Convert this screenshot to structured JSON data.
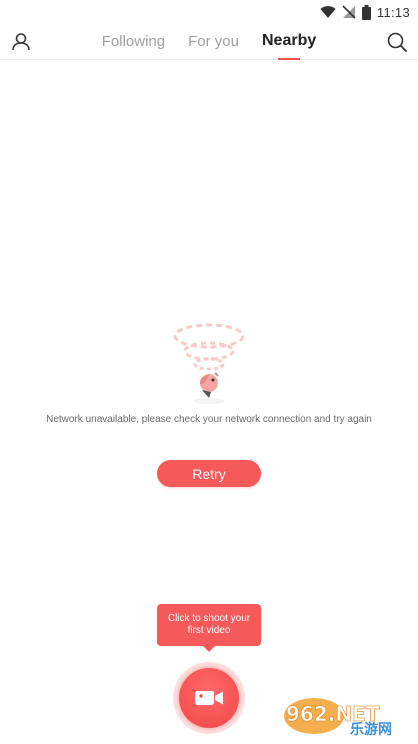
{
  "status_bar": {
    "time": "11:13",
    "icons": [
      "wifi-icon",
      "no-signal-icon",
      "battery-icon"
    ]
  },
  "nav": {
    "tabs": [
      {
        "label": "Following",
        "active": false
      },
      {
        "label": "For you",
        "active": false
      },
      {
        "label": "Nearby",
        "active": true
      }
    ],
    "left_icon": "profile-icon",
    "right_icon": "search-icon"
  },
  "empty_state": {
    "illustration": "no-network-illustration",
    "message": "Network unavailable, please check your network connection and try again",
    "retry_label": "Retry"
  },
  "record": {
    "tooltip": "Click to shoot your first video",
    "icon": "video-camera-icon"
  },
  "watermark": {
    "brand": "962.NET",
    "subtitle": "乐游网"
  },
  "colors": {
    "accent": "#f5595a",
    "active_tab_text": "#222222",
    "inactive_tab_text": "#a0a0a0"
  }
}
